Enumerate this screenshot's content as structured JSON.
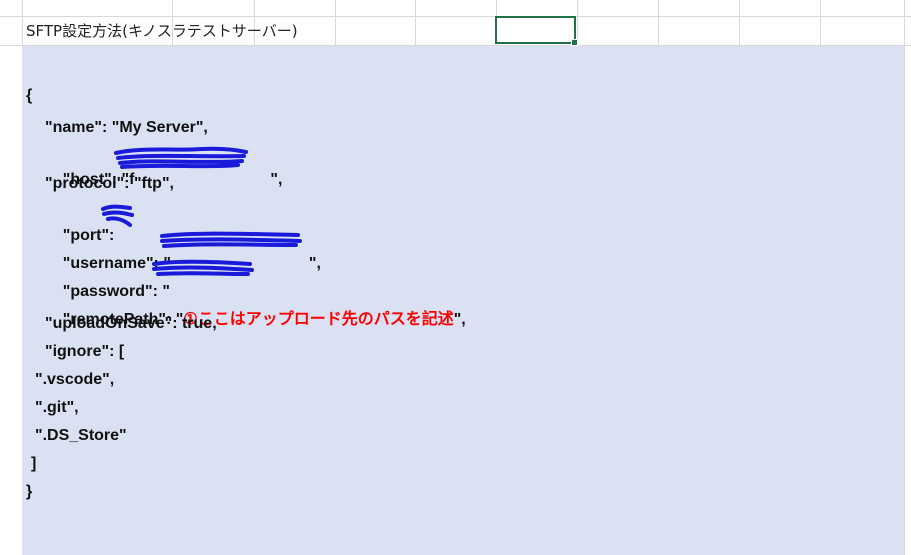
{
  "sheet": {
    "title_cell": "SFTP設定方法(キノスラテストサーバー)"
  },
  "code": {
    "open_brace": "{",
    "name_line": "\"name\": \"My Server\",",
    "host_key": "\"host\": \"f",
    "host_end": "\",",
    "protocol_line": "\"protocol\": \"ftp\",",
    "port_key": "\"port\":",
    "username_key": "\"username\": \"",
    "username_end": "\",",
    "password_key": "\"password\": \"",
    "password_end": "\",",
    "remote_key": "\"remotePath\": \"",
    "remote_value": "①ここはアップロード先のパスを記述",
    "remote_end": "\",",
    "upload_line": "\"uploadOnSave\": true,",
    "ignore_line": "\"ignore\": [",
    "vscode_line": "\".vscode\",",
    "git_line": "\".git\",",
    "ds_line": "\".DS_Store\"",
    "close_bracket": "]",
    "close_brace": "}"
  },
  "colors": {
    "code_background": "#d9e1f2",
    "selection_border": "#217346",
    "annotation_red": "#ff0000",
    "redaction_blue": "#1a1adb"
  }
}
